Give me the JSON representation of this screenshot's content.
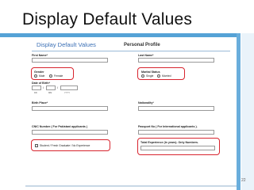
{
  "slide": {
    "title": "Display Default Values",
    "page_number": "22"
  },
  "form": {
    "title": "Display Default Values",
    "subtitle": "Personal Profile",
    "first_name_label": "First Name*",
    "last_name_label": "Last Name*",
    "gender": {
      "label": "Gender",
      "options": [
        "Male",
        "Female"
      ]
    },
    "marital_status": {
      "label": "Marital Status",
      "options": [
        "Single",
        "Married"
      ]
    },
    "date_of_birth": {
      "label": "Date of Birth*",
      "hint_day": "DD",
      "hint_month": "MM",
      "hint_year": "YYYY"
    },
    "birth_place_label": "Birth Place*",
    "nationality_label": "Nationality*",
    "cnic_label": "CNIC Number ( For Pakistani applicants )",
    "passport_label": "Passport No ( For International applicants ).",
    "experience_checkbox_label": "Student / Fresh Graduate / No Experience",
    "total_experience_label": "Total Experience (in years). Only Numbers."
  },
  "colors": {
    "accent_blue": "#55a2d6",
    "highlight_red": "#d8242e",
    "form_title_blue": "#3a6fb5"
  }
}
